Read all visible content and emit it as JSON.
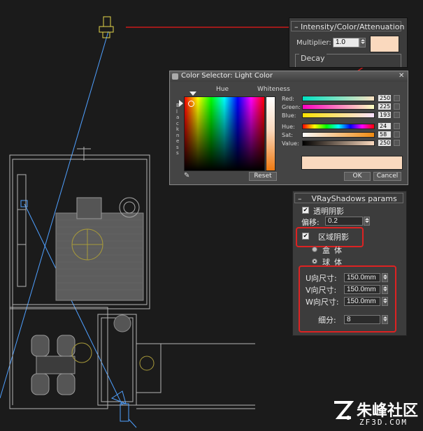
{
  "intensity": {
    "rollout_title": "Intensity/Color/Attenuation",
    "multiplier_label": "Multiplier:",
    "multiplier_value": "1.0",
    "decay_label": "Decay",
    "color_swatch": "#fad9be"
  },
  "color_selector": {
    "title": "Color Selector: Light Color",
    "hue_label": "Hue",
    "whiteness_label": "Whiteness",
    "blackness_label": "Blackness",
    "channels": [
      {
        "label": "Red:",
        "value": "250"
      },
      {
        "label": "Green:",
        "value": "225"
      },
      {
        "label": "Blue:",
        "value": "193"
      },
      {
        "label": "Hue:",
        "value": "24"
      },
      {
        "label": "Sat:",
        "value": "58"
      },
      {
        "label": "Value:",
        "value": "250"
      }
    ],
    "reset_label": "Reset",
    "ok_label": "OK",
    "cancel_label": "Cancel",
    "preview_color": "#fad9be"
  },
  "vray_shadows": {
    "rollout_title": "VRayShadows params",
    "transparent_label": "透明阴影",
    "bias_label": "偏移:",
    "bias_value": "0.2",
    "area_label": "区域阴影",
    "box_label": "盒体",
    "sphere_label": "球体",
    "u_label": "U向尺寸:",
    "u_value": "150.0mm",
    "v_label": "V向尺寸:",
    "v_value": "150.0mm",
    "w_label": "W向尺寸:",
    "w_value": "150.0mm",
    "subdiv_label": "细分:",
    "subdiv_value": "8"
  },
  "watermark": {
    "brand": "朱峰社区",
    "url": "ZF3D.COM"
  },
  "colors": {
    "highlight_red": "#d22222",
    "light_line_blue": "#4fa0ff",
    "light_icon_yellow": "#e3d44a"
  }
}
